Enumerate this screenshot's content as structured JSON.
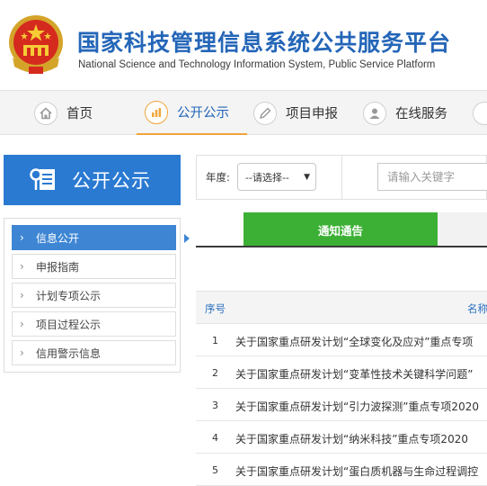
{
  "header": {
    "title_cn": "国家科技管理信息系统公共服务平台",
    "title_en": "National Science and Technology Information System, Public Service Platform"
  },
  "nav": {
    "items": [
      {
        "label": "首页",
        "icon": "home-icon"
      },
      {
        "label": "公开公示",
        "icon": "bar-chart-icon"
      },
      {
        "label": "项目申报",
        "icon": "pencil-icon"
      },
      {
        "label": "在线服务",
        "icon": "person-icon"
      }
    ],
    "active_index": 1
  },
  "sidebar": {
    "title": "公开公示",
    "items": [
      {
        "label": "信息公开"
      },
      {
        "label": "申报指南"
      },
      {
        "label": "计划专项公示"
      },
      {
        "label": "项目过程公示"
      },
      {
        "label": "信用警示信息"
      }
    ],
    "active_index": 0
  },
  "filter": {
    "year_label": "年度:",
    "year_value": "--请选择--",
    "keyword_placeholder": "请输入关键字"
  },
  "tabs": {
    "active_label": "通知通告"
  },
  "table": {
    "col_seq": "序号",
    "col_name": "名称",
    "rows": [
      {
        "num": "1",
        "title": "关于国家重点研发计划“全球变化及应对”重点专项"
      },
      {
        "num": "2",
        "title": "关于国家重点研发计划“变革性技术关键科学问题”"
      },
      {
        "num": "3",
        "title": "关于国家重点研发计划“引力波探测”重点专项2020"
      },
      {
        "num": "4",
        "title": "关于国家重点研发计划“纳米科技”重点专项2020"
      },
      {
        "num": "5",
        "title": "关于国家重点研发计划“蛋白质机器与生命过程调控"
      }
    ]
  },
  "colors": {
    "brand_blue": "#2466b8",
    "side_blue": "#2a7ad2",
    "active_item": "#3e86d4",
    "tab_green": "#3cb035",
    "nav_accent": "#f1a53a"
  }
}
